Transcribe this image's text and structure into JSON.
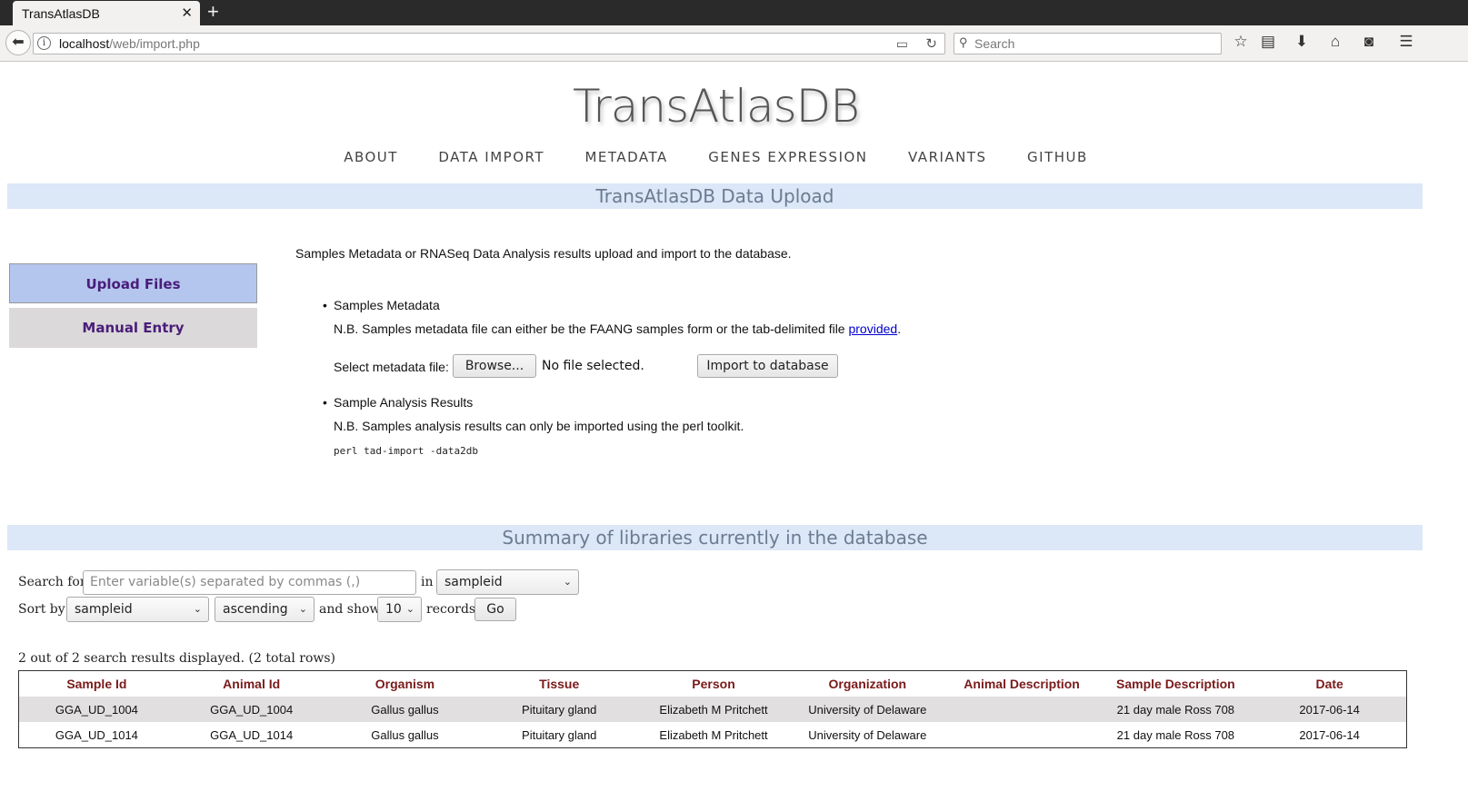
{
  "browser": {
    "tab_title": "TransAtlasDB",
    "url_host": "localhost",
    "url_path": "/web/import.php",
    "search_placeholder": "Search"
  },
  "site": {
    "title": "TransAtlasDB",
    "menu": [
      "ABOUT",
      "DATA IMPORT",
      "METADATA",
      "GENES EXPRESSION",
      "VARIANTS",
      "GITHUB"
    ]
  },
  "upload": {
    "heading": "TransAtlasDB Data Upload",
    "sidebar": [
      "Upload Files",
      "Manual Entry"
    ],
    "intro": "Samples Metadata or RNASeq Data Analysis results upload and import to the database.",
    "metadata_title": "Samples Metadata",
    "metadata_note": "N.B. Samples metadata file can either be the FAANG samples form or the tab-delimited file ",
    "metadata_link": "provided",
    "metadata_note_end": ".",
    "select_label": "Select metadata file:",
    "browse_label": "Browse...",
    "no_file": "No file selected.",
    "import_label": "Import to database",
    "analysis_title": "Sample Analysis Results",
    "analysis_note": "N.B. Samples analysis results can only be imported using the perl toolkit.",
    "command": "perl tad-import -data2db"
  },
  "summary": {
    "heading": "Summary of libraries currently in the database",
    "search_label": "Search for:",
    "search_placeholder": "Enter variable(s) separated by commas (,)",
    "in_label": "in",
    "in_value": "sampleid",
    "sort_label": "Sort by:",
    "sort_value": "sampleid",
    "order_value": "ascending",
    "show_label": "and show",
    "show_value": "10",
    "records_label": "records.",
    "go_label": "Go",
    "result_count": "2 out of 2 search results displayed. (2 total rows)",
    "columns": [
      "Sample Id",
      "Animal Id",
      "Organism",
      "Tissue",
      "Person",
      "Organization",
      "Animal Description",
      "Sample Description",
      "Date"
    ],
    "rows": [
      [
        "GGA_UD_1004",
        "GGA_UD_1004",
        "Gallus gallus",
        "Pituitary gland",
        "Elizabeth M Pritchett",
        "University of Delaware",
        "",
        "21 day male Ross 708",
        "2017-06-14"
      ],
      [
        "GGA_UD_1014",
        "GGA_UD_1014",
        "Gallus gallus",
        "Pituitary gland",
        "Elizabeth M Pritchett",
        "University of Delaware",
        "",
        "21 day male Ross 708",
        "2017-06-14"
      ]
    ]
  },
  "icons": [
    "back-icon",
    "info-icon",
    "reader-icon",
    "reload-icon",
    "search-icon",
    "bookmark-star-icon",
    "library-icon",
    "download-icon",
    "home-icon",
    "pocket-icon",
    "hamburger-menu-icon"
  ]
}
